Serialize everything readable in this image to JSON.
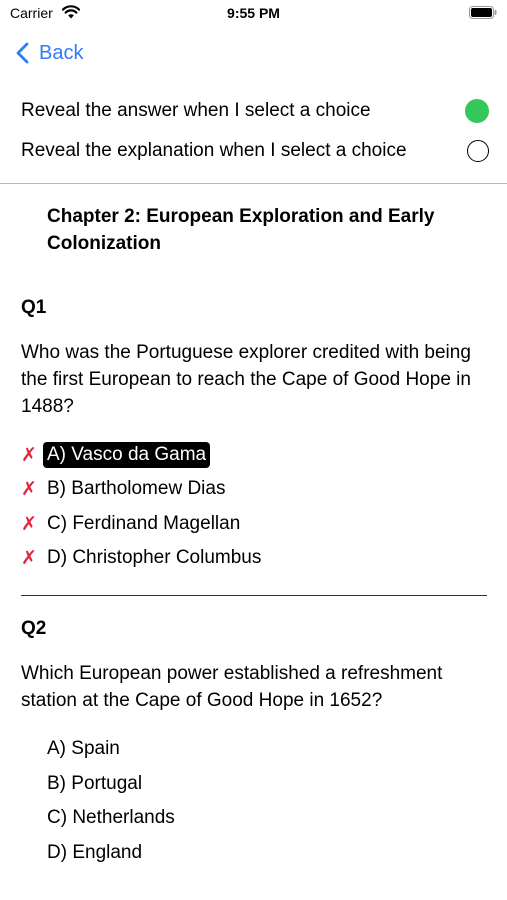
{
  "status_bar": {
    "carrier": "Carrier",
    "time": "9:55 PM"
  },
  "nav": {
    "back_label": "Back"
  },
  "settings": {
    "reveal_answer_label": "Reveal the answer when I select a choice",
    "reveal_answer_on": true,
    "reveal_explanation_label": "Reveal the explanation when I select a choice",
    "reveal_explanation_on": false
  },
  "colors": {
    "accent": "#2f7df6",
    "toggle_on": "#34c759",
    "wrong_mark": "#e0263f"
  },
  "chapter_title": "Chapter 2: European Exploration and Early Colonization",
  "questions": [
    {
      "number": "Q1",
      "text": "Who was the Portuguese explorer credited with being the first European to reach the Cape of Good Hope in 1488?",
      "choices": [
        {
          "label": "A) Vasco da Gama",
          "mark": "✗",
          "selected": true
        },
        {
          "label": "B) Bartholomew Dias",
          "mark": "✗",
          "selected": false
        },
        {
          "label": "C) Ferdinand Magellan",
          "mark": "✗",
          "selected": false
        },
        {
          "label": "D) Christopher Columbus",
          "mark": "✗",
          "selected": false
        }
      ]
    },
    {
      "number": "Q2",
      "text": "Which European power established a refreshment station at the Cape of Good Hope in 1652?",
      "choices": [
        {
          "label": "A) Spain",
          "mark": "",
          "selected": false
        },
        {
          "label": "B) Portugal",
          "mark": "",
          "selected": false
        },
        {
          "label": "C) Netherlands",
          "mark": "",
          "selected": false
        },
        {
          "label": "D) England",
          "mark": "",
          "selected": false
        }
      ]
    }
  ]
}
